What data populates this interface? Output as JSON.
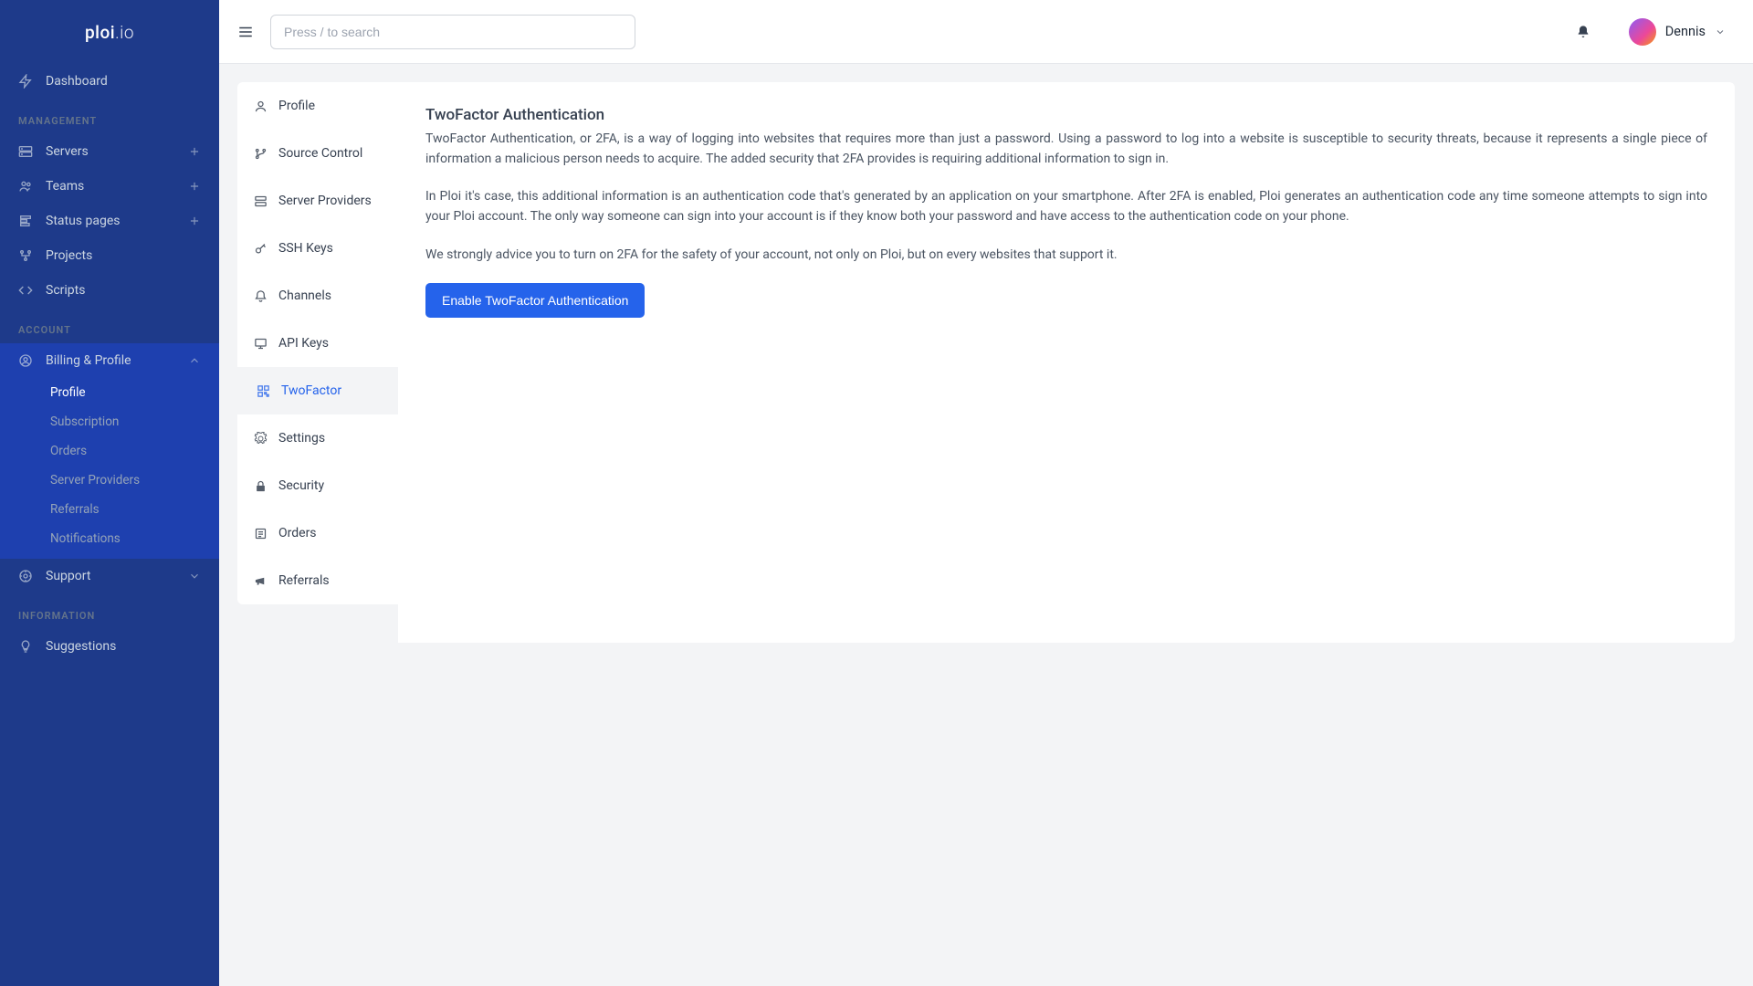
{
  "brand": {
    "name1": "ploi",
    "name2": ".io"
  },
  "search": {
    "placeholder": "Press / to search"
  },
  "user": {
    "name": "Dennis"
  },
  "sidebar": {
    "sections": {
      "management": {
        "title": "MANAGEMENT"
      },
      "account": {
        "title": "ACCOUNT"
      },
      "information": {
        "title": "INFORMATION"
      }
    },
    "dashboard": "Dashboard",
    "servers": "Servers",
    "teams": "Teams",
    "status_pages": "Status pages",
    "projects": "Projects",
    "scripts": "Scripts",
    "billing_profile": "Billing & Profile",
    "support": "Support",
    "suggestions": "Suggestions",
    "sub": {
      "profile": "Profile",
      "subscription": "Subscription",
      "orders": "Orders",
      "server_providers": "Server Providers",
      "referrals": "Referrals",
      "notifications": "Notifications"
    }
  },
  "sec": {
    "profile": "Profile",
    "source_control": "Source Control",
    "server_providers": "Server Providers",
    "ssh_keys": "SSH Keys",
    "channels": "Channels",
    "api_keys": "API Keys",
    "twofactor": "TwoFactor",
    "settings": "Settings",
    "security": "Security",
    "orders": "Orders",
    "referrals": "Referrals"
  },
  "content": {
    "title": "TwoFactor Authentication",
    "p1": "TwoFactor Authentication, or 2FA, is a way of logging into websites that requires more than just a password. Using a password to log into a website is susceptible to security threats, because it represents a single piece of information a malicious person needs to acquire. The added security that 2FA provides is requiring additional information to sign in.",
    "p2": "In Ploi it's case, this additional information is an authentication code that's generated by an application on your smartphone. After 2FA is enabled, Ploi generates an authentication code any time someone attempts to sign into your Ploi account. The only way someone can sign into your account is if they know both your password and have access to the authentication code on your phone.",
    "p3": "We strongly advice you to turn on 2FA for the safety of your account, not only on Ploi, but on every websites that support it.",
    "button": "Enable TwoFactor Authentication"
  }
}
